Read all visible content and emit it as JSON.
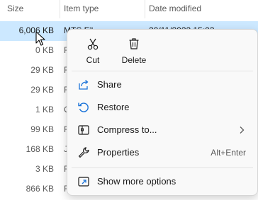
{
  "header": {
    "size_label": "Size",
    "type_label": "Item type",
    "date_label": "Date modified"
  },
  "rows": [
    {
      "size": "6,006 KB",
      "type": "MTS Fil",
      "date": "20/11/2022 15:03",
      "selected": true
    },
    {
      "size": "0 KB",
      "type": "F",
      "date": ""
    },
    {
      "size": "29 KB",
      "type": "F",
      "date": ""
    },
    {
      "size": "29 KB",
      "type": "F",
      "date": ""
    },
    {
      "size": "1 KB",
      "type": "C",
      "date": ""
    },
    {
      "size": "99 KB",
      "type": "F",
      "date": ""
    },
    {
      "size": "168 KB",
      "type": "J",
      "date": ""
    },
    {
      "size": "3 KB",
      "type": "F",
      "date": ""
    },
    {
      "size": "866 KB",
      "type": "F",
      "date": ""
    }
  ],
  "menu": {
    "quick": {
      "cut_label": "Cut",
      "delete_label": "Delete"
    },
    "items": {
      "share": {
        "label": "Share"
      },
      "restore": {
        "label": "Restore"
      },
      "compress": {
        "label": "Compress to..."
      },
      "properties": {
        "label": "Properties",
        "shortcut": "Alt+Enter"
      },
      "more": {
        "label": "Show more options"
      }
    }
  },
  "colors": {
    "selection": "#cce8ff",
    "menu_bg": "#f9f9f9",
    "text": "#1a1a1a",
    "muted": "#5b5b5b"
  },
  "icons": [
    "scissors-icon",
    "trash-icon",
    "share-icon",
    "restore-icon",
    "archive-icon",
    "wrench-icon",
    "external-window-icon",
    "chevron-right-icon",
    "mouse-cursor-icon"
  ]
}
